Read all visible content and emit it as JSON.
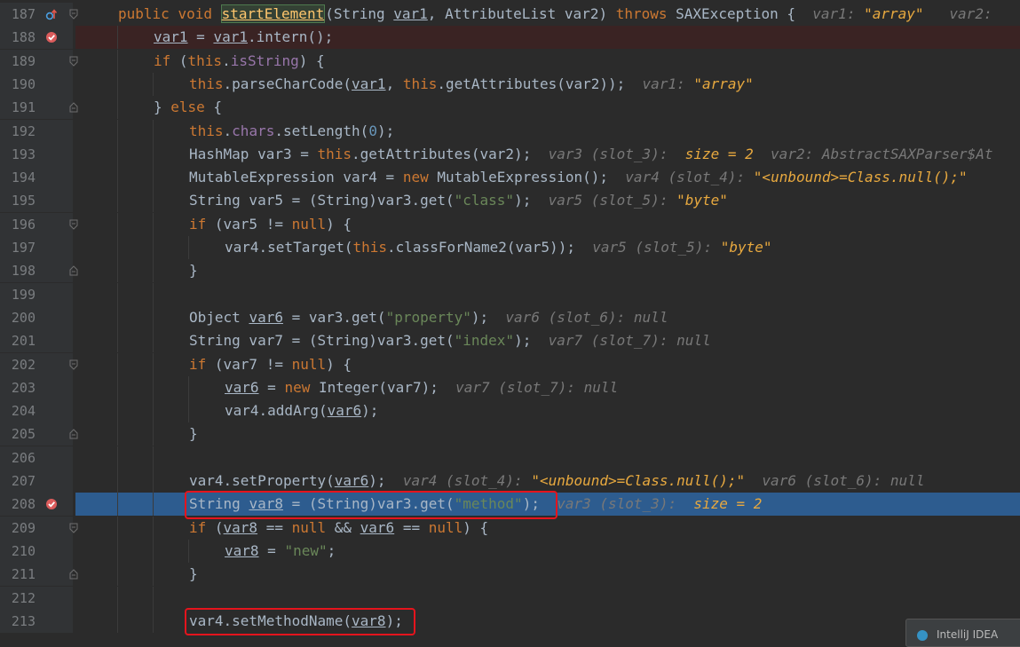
{
  "editor": {
    "lines": [
      {
        "n": "187",
        "tokens": [
          [
            "kw",
            "public"
          ],
          [
            "t",
            " "
          ],
          [
            "kw",
            "void"
          ],
          [
            "t",
            " "
          ],
          [
            "fnhl",
            "startElement"
          ],
          [
            "t",
            "(String "
          ],
          [
            "ul",
            "var1"
          ],
          [
            "t",
            ", AttributeList var2) "
          ],
          [
            "kw",
            "throws"
          ],
          [
            "t",
            " SAXException {  "
          ],
          [
            "hint",
            "var1: "
          ],
          [
            "hv",
            "\"array\""
          ],
          [
            "hint",
            "   var2: "
          ]
        ]
      },
      {
        "n": "188",
        "tokens": [
          [
            "ul",
            "var1"
          ],
          [
            "t",
            " = "
          ],
          [
            "ul",
            "var1"
          ],
          [
            "t",
            ".intern();"
          ]
        ]
      },
      {
        "n": "189",
        "tokens": [
          [
            "kw",
            "if"
          ],
          [
            "t",
            " ("
          ],
          [
            "kw",
            "this"
          ],
          [
            "t",
            "."
          ],
          [
            "fd",
            "isString"
          ],
          [
            "t",
            ") {"
          ]
        ]
      },
      {
        "n": "190",
        "tokens": [
          [
            "kw",
            "this"
          ],
          [
            "t",
            ".parseCharCode("
          ],
          [
            "ul",
            "var1"
          ],
          [
            "t",
            ", "
          ],
          [
            "kw",
            "this"
          ],
          [
            "t",
            ".getAttributes(var2));  "
          ],
          [
            "hint",
            "var1: "
          ],
          [
            "hv",
            "\"array\""
          ]
        ]
      },
      {
        "n": "191",
        "tokens": [
          [
            "t",
            "} "
          ],
          [
            "kw",
            "else"
          ],
          [
            "t",
            " {"
          ]
        ]
      },
      {
        "n": "192",
        "tokens": [
          [
            "kw",
            "this"
          ],
          [
            "t",
            "."
          ],
          [
            "fd",
            "chars"
          ],
          [
            "t",
            ".setLength("
          ],
          [
            "nm",
            "0"
          ],
          [
            "t",
            ");"
          ]
        ]
      },
      {
        "n": "193",
        "tokens": [
          [
            "t",
            "HashMap var3 = "
          ],
          [
            "kw",
            "this"
          ],
          [
            "t",
            ".getAttributes(var2);  "
          ],
          [
            "hint",
            "var3 (slot_3):  "
          ],
          [
            "hv",
            "size = 2"
          ],
          [
            "hint",
            "  var2: AbstractSAXParser$At"
          ]
        ]
      },
      {
        "n": "194",
        "tokens": [
          [
            "t",
            "MutableExpression var4 = "
          ],
          [
            "kw",
            "new"
          ],
          [
            "t",
            " MutableExpression();  "
          ],
          [
            "hint",
            "var4 (slot_4): "
          ],
          [
            "hv",
            "\"<unbound>=Class.null();\""
          ]
        ]
      },
      {
        "n": "195",
        "tokens": [
          [
            "t",
            "String var5 = (String)var3.get("
          ],
          [
            "st",
            "\"class\""
          ],
          [
            "t",
            ");  "
          ],
          [
            "hint",
            "var5 (slot_5): "
          ],
          [
            "hv",
            "\"byte\""
          ]
        ]
      },
      {
        "n": "196",
        "tokens": [
          [
            "kw",
            "if"
          ],
          [
            "t",
            " (var5 != "
          ],
          [
            "kw",
            "null"
          ],
          [
            "t",
            ") {"
          ]
        ]
      },
      {
        "n": "197",
        "tokens": [
          [
            "t",
            "var4.setTarget("
          ],
          [
            "kw",
            "this"
          ],
          [
            "t",
            ".classForName2(var5));  "
          ],
          [
            "hint",
            "var5 (slot_5): "
          ],
          [
            "hv",
            "\"byte\""
          ]
        ]
      },
      {
        "n": "198",
        "tokens": [
          [
            "t",
            "}"
          ]
        ]
      },
      {
        "n": "199",
        "tokens": []
      },
      {
        "n": "200",
        "tokens": [
          [
            "t",
            "Object "
          ],
          [
            "ul",
            "var6"
          ],
          [
            "t",
            " = var3.get("
          ],
          [
            "st",
            "\"property\""
          ],
          [
            "t",
            ");  "
          ],
          [
            "hint",
            "var6 (slot_6): null"
          ]
        ]
      },
      {
        "n": "201",
        "tokens": [
          [
            "t",
            "String var7 = (String)var3.get("
          ],
          [
            "st",
            "\"index\""
          ],
          [
            "t",
            ");  "
          ],
          [
            "hint",
            "var7 (slot_7): null"
          ]
        ]
      },
      {
        "n": "202",
        "tokens": [
          [
            "kw",
            "if"
          ],
          [
            "t",
            " (var7 != "
          ],
          [
            "kw",
            "null"
          ],
          [
            "t",
            ") {"
          ]
        ]
      },
      {
        "n": "203",
        "tokens": [
          [
            "ul",
            "var6"
          ],
          [
            "t",
            " = "
          ],
          [
            "kw",
            "new"
          ],
          [
            "t",
            " Integer(var7);  "
          ],
          [
            "hint",
            "var7 (slot_7): null"
          ]
        ]
      },
      {
        "n": "204",
        "tokens": [
          [
            "t",
            "var4.addArg("
          ],
          [
            "ul",
            "var6"
          ],
          [
            "t",
            ");"
          ]
        ]
      },
      {
        "n": "205",
        "tokens": [
          [
            "t",
            "}"
          ]
        ]
      },
      {
        "n": "206",
        "tokens": []
      },
      {
        "n": "207",
        "tokens": [
          [
            "t",
            "var4.setProperty("
          ],
          [
            "ul",
            "var6"
          ],
          [
            "t",
            ");  "
          ],
          [
            "hint",
            "var4 (slot_4): "
          ],
          [
            "hv",
            "\"<unbound>=Class.null();\""
          ],
          [
            "hint",
            "  var6 (slot_6): null"
          ]
        ]
      },
      {
        "n": "208",
        "tokens": [
          [
            "t",
            "String "
          ],
          [
            "ul",
            "var8"
          ],
          [
            "t",
            " = (String)var3.get("
          ],
          [
            "st",
            "\"method\""
          ],
          [
            "t",
            ");  "
          ],
          [
            "hint",
            "var3 (slot_3):  "
          ],
          [
            "hv",
            "size = 2"
          ]
        ]
      },
      {
        "n": "209",
        "tokens": [
          [
            "kw",
            "if"
          ],
          [
            "t",
            " ("
          ],
          [
            "ul",
            "var8"
          ],
          [
            "t",
            " == "
          ],
          [
            "kw",
            "null"
          ],
          [
            "t",
            " && "
          ],
          [
            "ul",
            "var6"
          ],
          [
            "t",
            " == "
          ],
          [
            "kw",
            "null"
          ],
          [
            "t",
            ") {"
          ]
        ]
      },
      {
        "n": "210",
        "tokens": [
          [
            "ul",
            "var8"
          ],
          [
            "t",
            " = "
          ],
          [
            "st",
            "\"new\""
          ],
          [
            "t",
            ";"
          ]
        ]
      },
      {
        "n": "211",
        "tokens": [
          [
            "t",
            "}"
          ]
        ]
      },
      {
        "n": "212",
        "tokens": []
      },
      {
        "n": "213",
        "tokens": [
          [
            "t",
            "var4.setMethodName("
          ],
          [
            "ul",
            "var8"
          ],
          [
            "t",
            ");"
          ]
        ]
      }
    ]
  },
  "notification": {
    "text": "IntelliJ IDEA"
  },
  "colors": {
    "background": "#2b2b2b",
    "gutter": "#313335",
    "current_line": "#2d5c8f",
    "breakpoint_line": "#3a2323",
    "breakpoint": "#db5c5c",
    "annotation_box": "#e5141d"
  },
  "icons": {
    "line_187": "override-method-icon",
    "line_188": "breakpoint-icon",
    "line_208": "breakpoint-icon"
  }
}
